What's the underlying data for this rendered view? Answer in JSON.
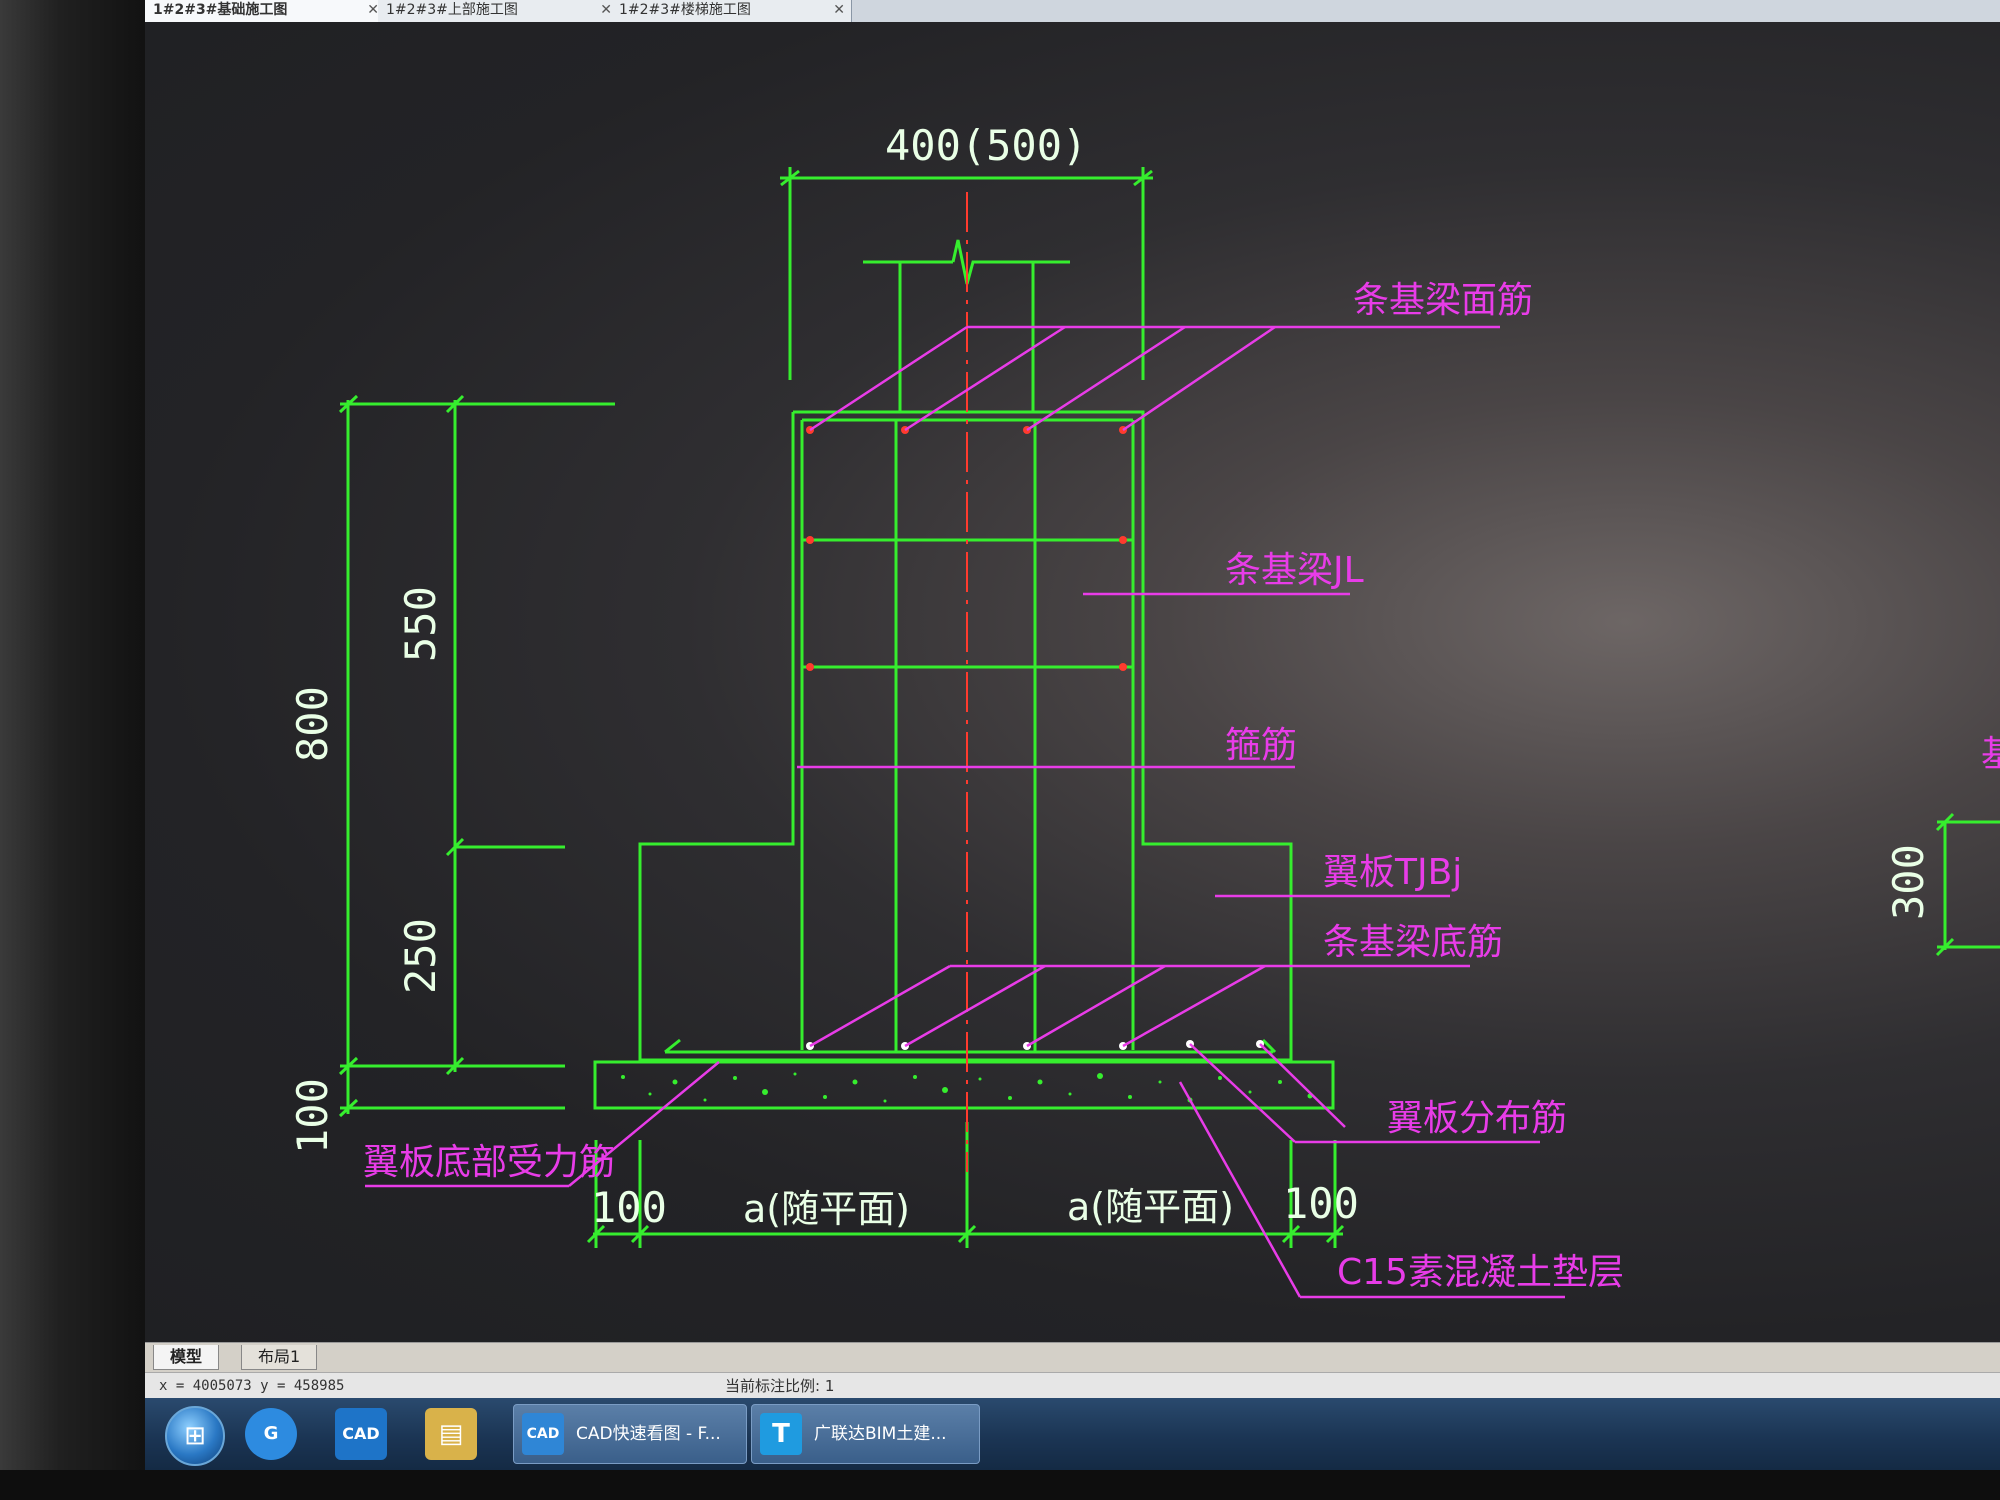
{
  "doc_tabs": [
    {
      "label": "1#2#3#基础施工图",
      "active": true
    },
    {
      "label": "1#2#3#上部施工图",
      "active": false
    },
    {
      "label": "1#2#3#楼梯施工图",
      "active": false
    }
  ],
  "drawing": {
    "top_width_dim": "400(500)",
    "dim_800": "800",
    "dim_550": "550",
    "dim_250": "250",
    "dim_100_left": "100",
    "dim_300": "300",
    "bottom_dim_100_left": "100",
    "bottom_dim_a_left": "a(随平面)",
    "bottom_dim_a_right": "a(随平面)",
    "bottom_dim_100_right": "100",
    "labels": {
      "beam_top_bar": "条基梁面筋",
      "beam_jl": "条基梁JL",
      "stirrup": "箍筋",
      "wing_plate": "翼板TJBj",
      "beam_bottom_bar": "条基梁底筋",
      "wing_bottom_bar": "翼板底部受力筋",
      "wing_dist_bar": "翼板分布筋",
      "c15_cushion": "C15素混凝土垫层",
      "right_partial": "基"
    }
  },
  "layout_tabs": [
    {
      "label": "模型",
      "active": true
    },
    {
      "label": "布局1",
      "active": false
    }
  ],
  "status": {
    "coords": "x = 4005073  y = 458985",
    "scale": "当前标注比例: 1"
  },
  "taskbar": {
    "start_glyph": "⊞",
    "icons": [
      {
        "name": "browser",
        "label": "G",
        "color": "#2d8be0"
      },
      {
        "name": "cad-app",
        "label": "CAD",
        "color": "#1e74c8"
      },
      {
        "name": "file-explorer",
        "label": "▤",
        "color": "#d9b24a"
      }
    ],
    "tasks": [
      {
        "label": "CAD快速看图 - F...",
        "icon": "CAD"
      },
      {
        "label": "广联达BIM土建...",
        "icon": "T"
      }
    ]
  },
  "colors": {
    "green": "#36ee2e",
    "magenta": "#e83ce8",
    "red_axis": "#ff3b2e"
  }
}
